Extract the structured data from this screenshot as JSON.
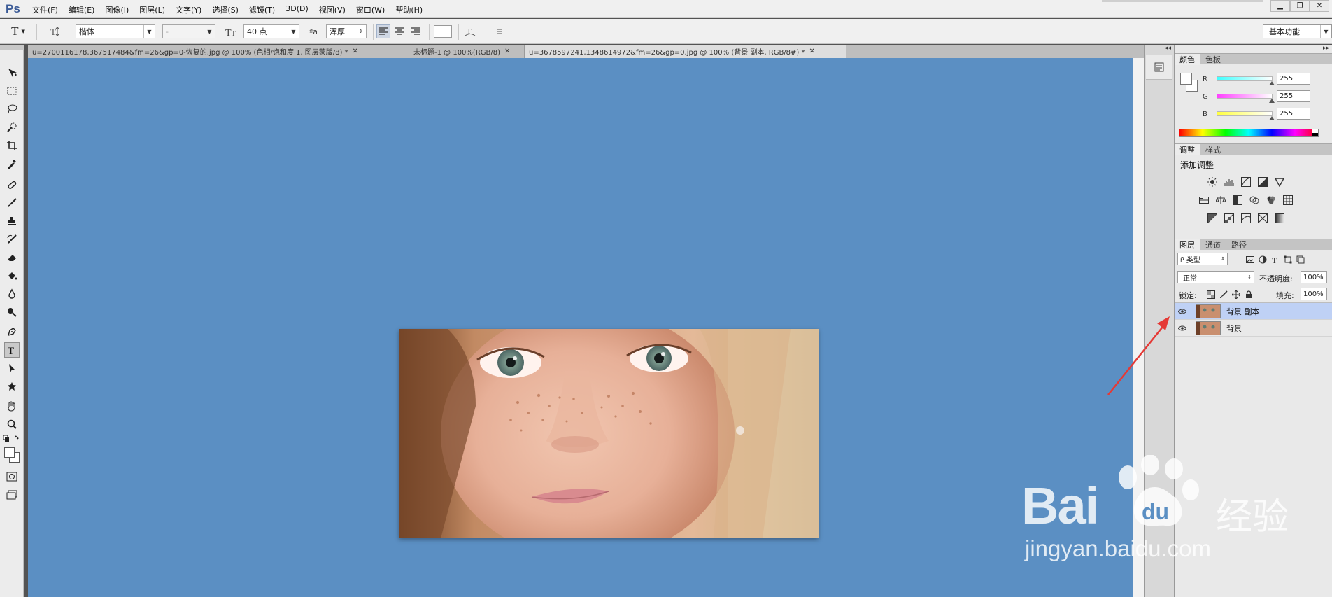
{
  "app": {
    "logo": "Ps",
    "menu": [
      "文件(F)",
      "编辑(E)",
      "图像(I)",
      "图层(L)",
      "文字(Y)",
      "选择(S)",
      "滤镜(T)",
      "3D(D)",
      "视图(V)",
      "窗口(W)",
      "帮助(H)"
    ],
    "window_controls": [
      "▁",
      "❐",
      "✕"
    ]
  },
  "options": {
    "tool_glyph": "T",
    "font_family": "楷体",
    "font_style": "-",
    "font_size": "40 点",
    "aa_label": "ªa",
    "aa_method": "浑厚",
    "workspace": "基本功能"
  },
  "tabs": [
    {
      "title": "u=2700116178,367517484&fm=26&gp=0-恢复的.jpg @ 100% (色相/饱和度 1, 图层蒙版/8) *",
      "close": "✕"
    },
    {
      "title": "未标题-1 @ 100%(RGB/8)",
      "close": "✕"
    },
    {
      "title": "u=3678597241,1348614972&fm=26&gp=0.jpg @ 100% (背景 副本, RGB/8#) *",
      "close": "✕"
    }
  ],
  "colors": {
    "canvas_bg": "#5b8fc3",
    "selection": "#bfd1f5",
    "arrow": "#e53935"
  },
  "color_panel": {
    "tabs": [
      "颜色",
      "色板"
    ],
    "channels": [
      {
        "label": "R",
        "value": "255"
      },
      {
        "label": "G",
        "value": "255"
      },
      {
        "label": "B",
        "value": "255"
      }
    ]
  },
  "adjust_panel": {
    "tabs": [
      "调整",
      "样式"
    ],
    "title": "添加调整"
  },
  "layers_panel": {
    "tabs": [
      "图层",
      "通道",
      "路径"
    ],
    "filter": "类型",
    "blend_mode": "正常",
    "opacity_label": "不透明度:",
    "opacity": "100%",
    "lock_label": "锁定:",
    "fill_label": "填充:",
    "fill": "100%",
    "layers": [
      {
        "name": "背景 副本",
        "selected": true
      },
      {
        "name": "背景",
        "selected": false
      }
    ]
  },
  "watermark": {
    "main": "Bai",
    "main_tail": "du",
    "cn": "经验",
    "url": "jingyan.baidu.com"
  }
}
